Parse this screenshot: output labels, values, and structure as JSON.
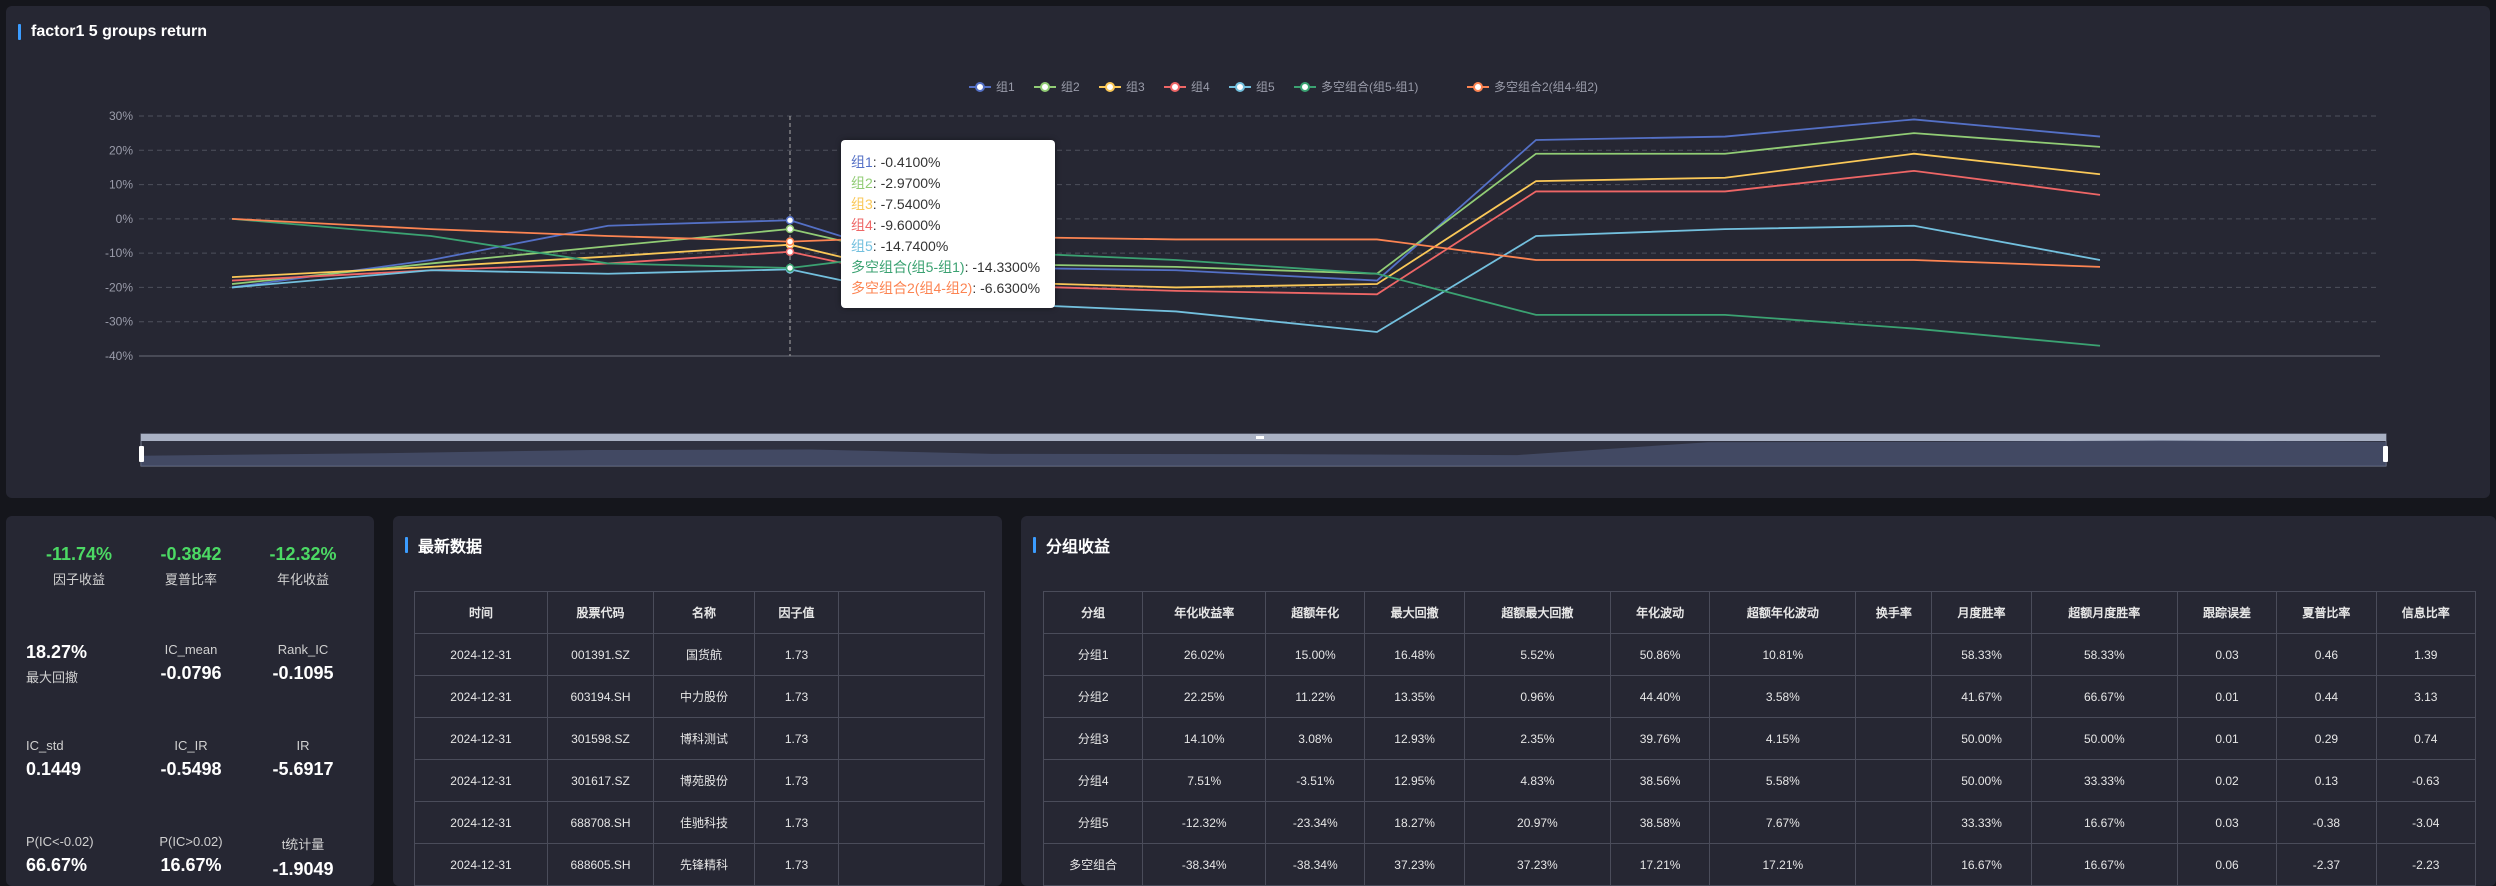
{
  "chart_panel": {
    "title": "factor1 5 groups return"
  },
  "chart_data": {
    "type": "line",
    "title": "factor1 5 groups return",
    "y_ticks": [
      "30%",
      "20%",
      "10%",
      "0%",
      "-10%",
      "-20%",
      "-30%",
      "-40%"
    ],
    "ylim": [
      -40,
      30
    ],
    "x_count": 10,
    "tooltip_index": 3,
    "series": [
      {
        "name": "组1",
        "color": "#5470c6",
        "values": [
          -20,
          -12,
          -2,
          -0.41,
          -14,
          -15,
          -18,
          23,
          24,
          29,
          24
        ]
      },
      {
        "name": "组2",
        "color": "#91cc75",
        "values": [
          -19,
          -13,
          -8,
          -2.97,
          -13,
          -14,
          -16,
          19,
          19,
          25,
          21
        ]
      },
      {
        "name": "组3",
        "color": "#fac858",
        "values": [
          -17,
          -14,
          -11,
          -7.54,
          -18,
          -20,
          -19,
          11,
          12,
          19,
          13
        ]
      },
      {
        "name": "组4",
        "color": "#ee6666",
        "values": [
          -18,
          -15,
          -13,
          -9.6,
          -19,
          -21,
          -22,
          8,
          8,
          14,
          7
        ]
      },
      {
        "name": "组5",
        "color": "#73c0de",
        "values": [
          -20,
          -15,
          -16,
          -14.74,
          -24,
          -27,
          -33,
          -5,
          -3,
          -2,
          -12
        ]
      },
      {
        "name": "多空组合(组5-组1)",
        "color": "#3ba272",
        "values": [
          0,
          -5,
          -13,
          -14.33,
          -9,
          -12,
          -16,
          -28,
          -28,
          -32,
          -37
        ]
      },
      {
        "name": "多空组合2(组4-组2)",
        "color": "#fc8452",
        "values": [
          0,
          -3,
          -5,
          -6.63,
          -5,
          -6,
          -6,
          -12,
          -12,
          -12,
          -14
        ]
      }
    ],
    "tooltip_values": [
      "-0.4100%",
      "-2.9700%",
      "-7.5400%",
      "-9.6000%",
      "-14.7400%",
      "-14.3300%",
      "-6.6300%"
    ]
  },
  "stats": [
    {
      "value": "-11.74%",
      "label": "因子收益",
      "color": "#4cd964",
      "value_first": true
    },
    {
      "value": "-0.3842",
      "label": "夏普比率",
      "color": "#4cd964",
      "value_first": true
    },
    {
      "value": "-12.32%",
      "label": "年化收益",
      "color": "#4cd964",
      "value_first": true
    },
    {
      "value": "18.27%",
      "label": "最大回撤",
      "color": "#ffffff",
      "value_first": true
    },
    {
      "value": "-0.0796",
      "label": "IC_mean",
      "color": "#ffffff",
      "value_first": false
    },
    {
      "value": "-0.1095",
      "label": "Rank_IC",
      "color": "#ffffff",
      "value_first": false
    },
    {
      "value": "0.1449",
      "label": "IC_std",
      "color": "#ffffff",
      "value_first": false
    },
    {
      "value": "-0.5498",
      "label": "IC_IR",
      "color": "#ffffff",
      "value_first": false
    },
    {
      "value": "-5.6917",
      "label": "IR",
      "color": "#ffffff",
      "value_first": false
    },
    {
      "value": "66.67%",
      "label": "P(IC<-0.02)",
      "color": "#ffffff",
      "value_first": false
    },
    {
      "value": "16.67%",
      "label": "P(IC>0.02)",
      "color": "#ffffff",
      "value_first": false
    },
    {
      "value": "-1.9049",
      "label": "t统计量",
      "color": "#ffffff",
      "value_first": false
    }
  ],
  "latest": {
    "title": "最新数据",
    "headers": [
      "时间",
      "股票代码",
      "名称",
      "因子值"
    ],
    "rows": [
      [
        "2024-12-31",
        "001391.SZ",
        "国货航",
        "1.73"
      ],
      [
        "2024-12-31",
        "603194.SH",
        "中力股份",
        "1.73"
      ],
      [
        "2024-12-31",
        "301598.SZ",
        "博科测试",
        "1.73"
      ],
      [
        "2024-12-31",
        "301617.SZ",
        "博苑股份",
        "1.73"
      ],
      [
        "2024-12-31",
        "688708.SH",
        "佳驰科技",
        "1.73"
      ],
      [
        "2024-12-31",
        "688605.SH",
        "先锋精科",
        "1.73"
      ]
    ]
  },
  "group": {
    "title": "分组收益",
    "headers": [
      "分组",
      "年化收益率",
      "超额年化",
      "最大回撤",
      "超额最大回撤",
      "年化波动",
      "超额年化波动",
      "换手率",
      "月度胜率",
      "超额月度胜率",
      "跟踪误差",
      "夏普比率",
      "信息比率"
    ],
    "rows": [
      [
        "分组1",
        "26.02%",
        "15.00%",
        "16.48%",
        "5.52%",
        "50.86%",
        "10.81%",
        "",
        "58.33%",
        "58.33%",
        "0.03",
        "0.46",
        "1.39"
      ],
      [
        "分组2",
        "22.25%",
        "11.22%",
        "13.35%",
        "0.96%",
        "44.40%",
        "3.58%",
        "",
        "41.67%",
        "66.67%",
        "0.01",
        "0.44",
        "3.13"
      ],
      [
        "分组3",
        "14.10%",
        "3.08%",
        "12.93%",
        "2.35%",
        "39.76%",
        "4.15%",
        "",
        "50.00%",
        "50.00%",
        "0.01",
        "0.29",
        "0.74"
      ],
      [
        "分组4",
        "7.51%",
        "-3.51%",
        "12.95%",
        "4.83%",
        "38.56%",
        "5.58%",
        "",
        "50.00%",
        "33.33%",
        "0.02",
        "0.13",
        "-0.63"
      ],
      [
        "分组5",
        "-12.32%",
        "-23.34%",
        "18.27%",
        "20.97%",
        "38.58%",
        "7.67%",
        "",
        "33.33%",
        "16.67%",
        "0.03",
        "-0.38",
        "-3.04"
      ],
      [
        "多空组合",
        "-38.34%",
        "-38.34%",
        "37.23%",
        "37.23%",
        "17.21%",
        "17.21%",
        "",
        "16.67%",
        "16.67%",
        "0.06",
        "-2.37",
        "-2.23"
      ]
    ]
  }
}
